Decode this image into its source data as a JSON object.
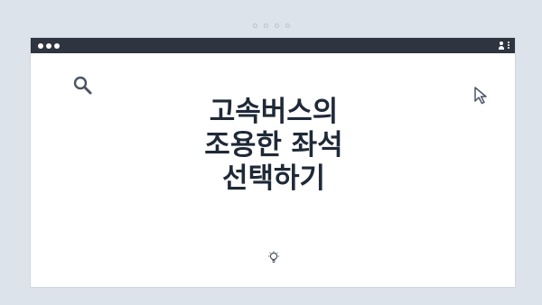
{
  "pager": {
    "dots": 4
  },
  "window": {
    "titlebar_icons": [
      "window-control-dot",
      "window-control-dot",
      "window-control-dot",
      "user-icon",
      "kebab-menu-icon"
    ]
  },
  "content": {
    "title_lines": [
      "고속버스의",
      "조용한 좌석",
      "선택하기"
    ],
    "icons": [
      "search-icon",
      "cursor-arrow-icon",
      "lightbulb-icon"
    ]
  },
  "colors": {
    "page_background": "#dde3ea",
    "titlebar": "#2e3440",
    "window_background": "#ffffff",
    "title_text": "#1f2937",
    "icon_stroke": "#4b5563"
  }
}
